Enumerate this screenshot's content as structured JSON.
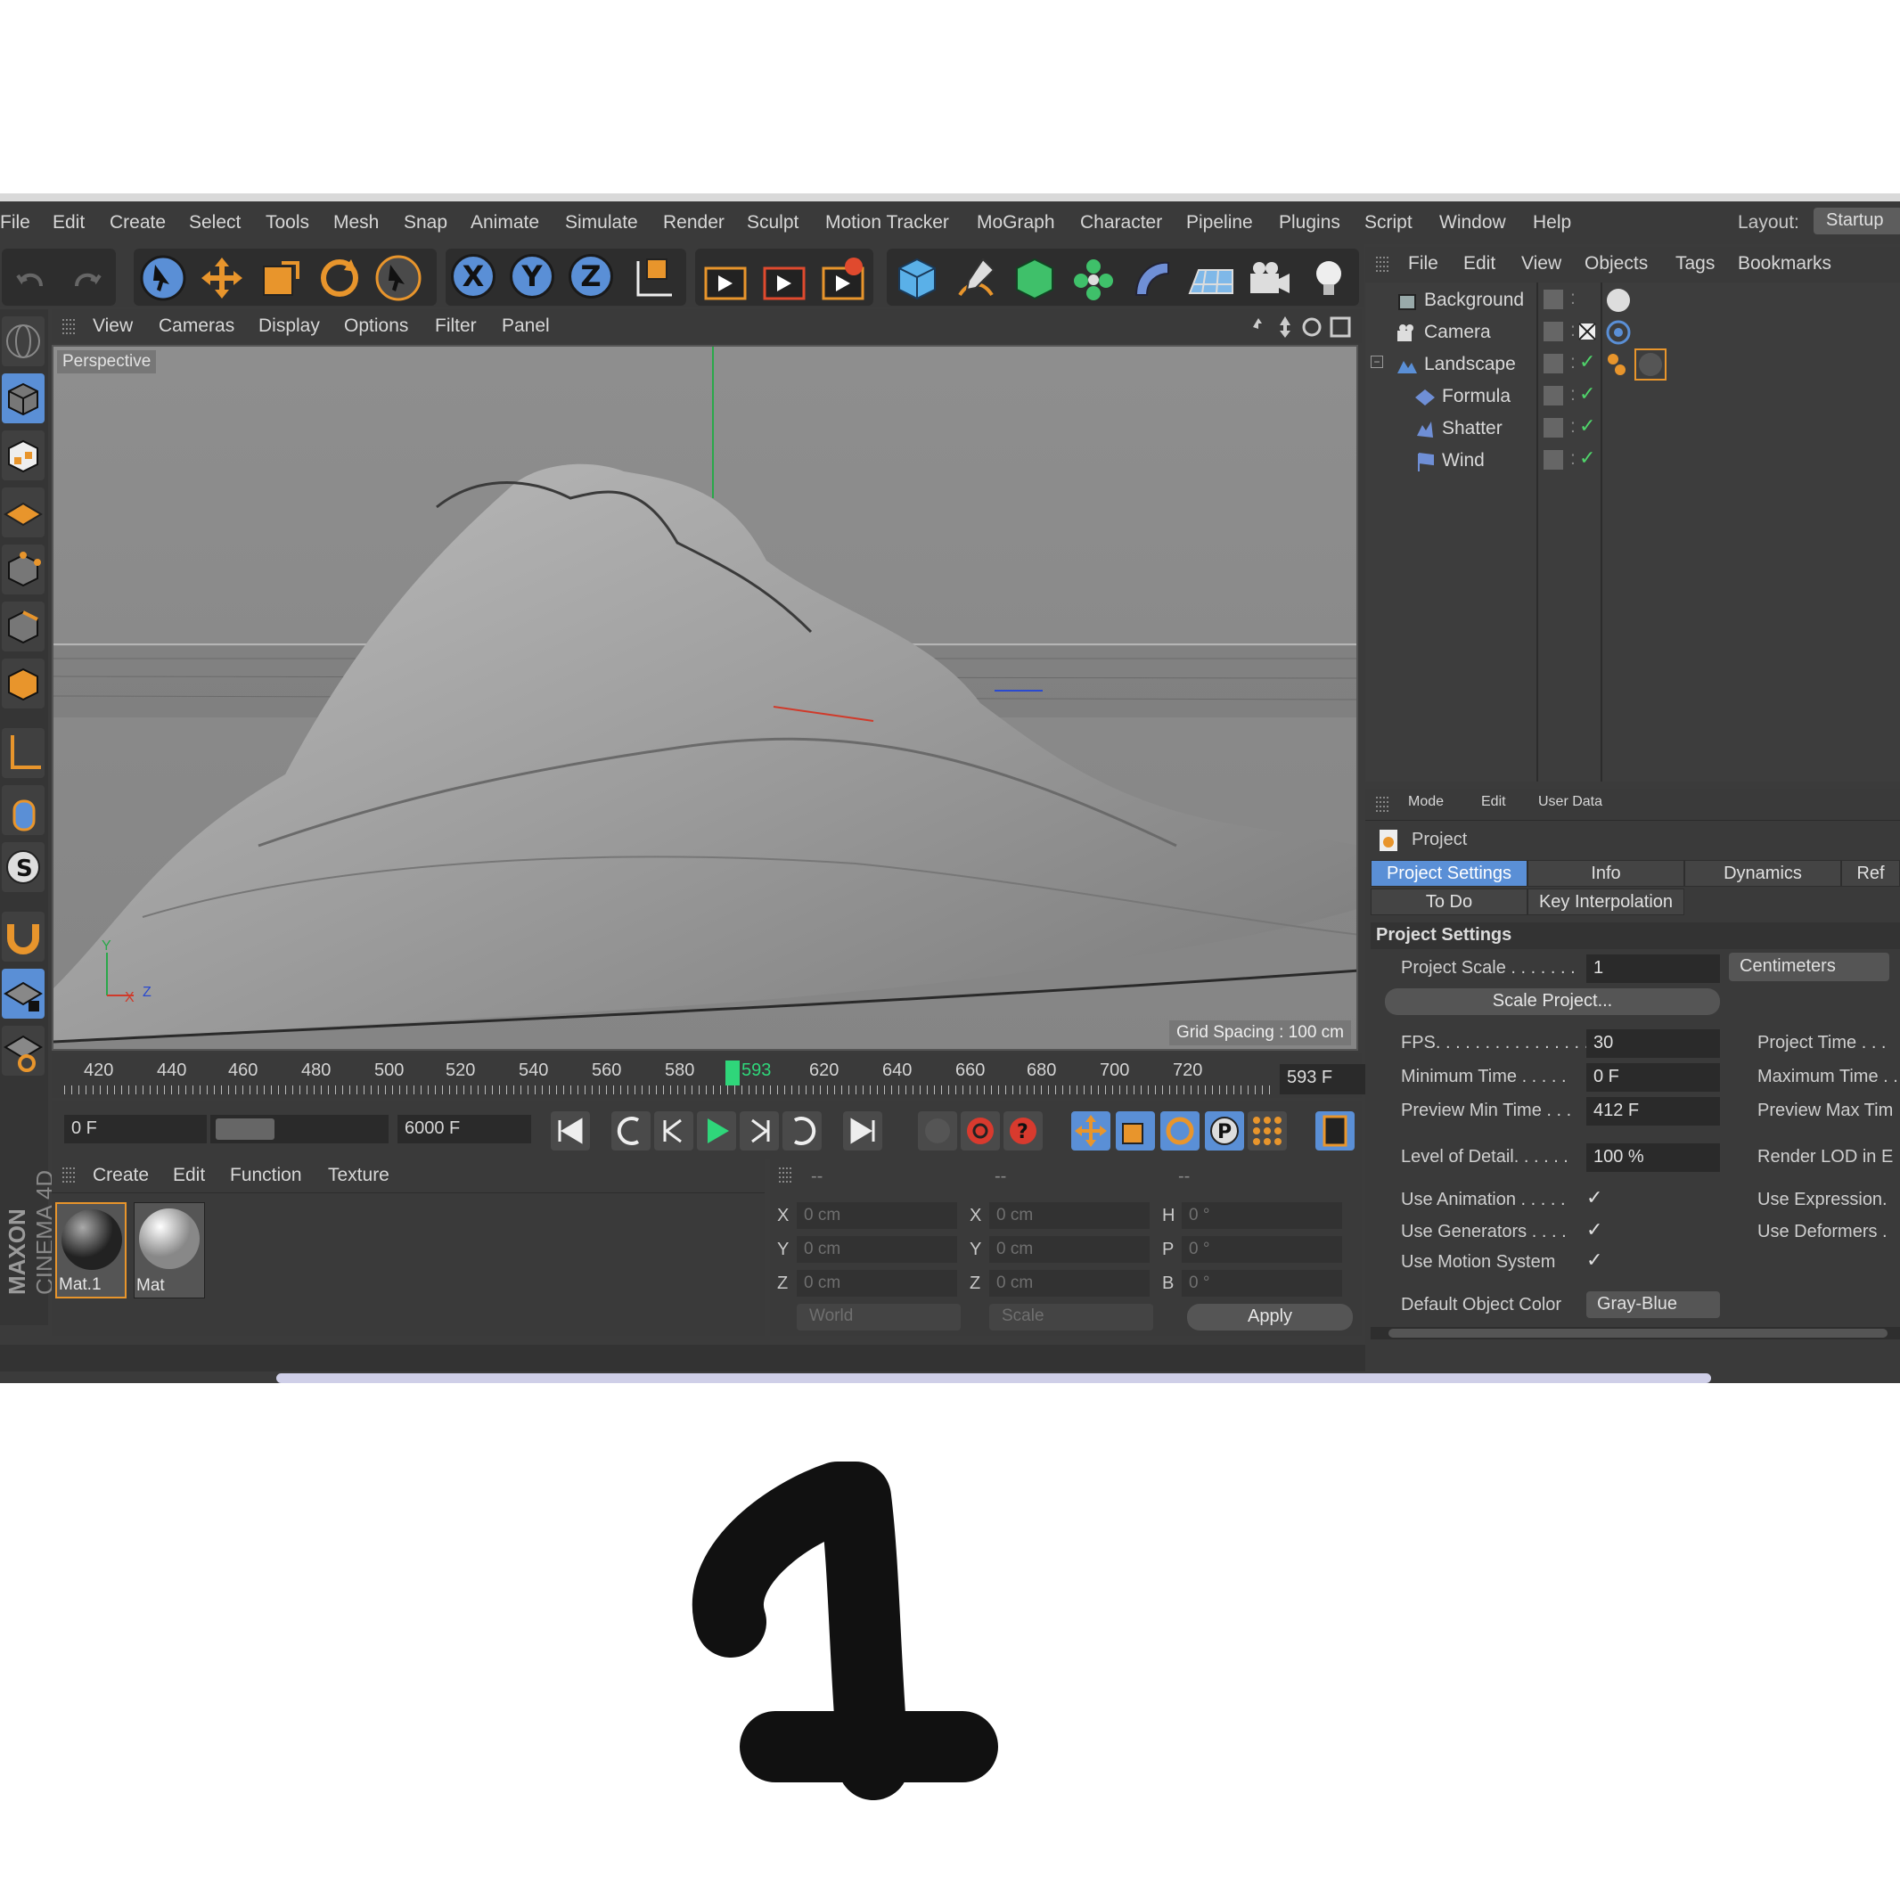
{
  "menubar": {
    "items": [
      "File",
      "Edit",
      "Create",
      "Select",
      "Tools",
      "Mesh",
      "Snap",
      "Animate",
      "Simulate",
      "Render",
      "Sculpt",
      "Motion Tracker",
      "MoGraph",
      "Character",
      "Pipeline",
      "Plugins",
      "Script",
      "Window",
      "Help"
    ],
    "layout_label": "Layout:",
    "layout_value": "Startup"
  },
  "main_toolbar": {
    "axis_buttons": [
      "X",
      "Y",
      "Z"
    ]
  },
  "viewport": {
    "menu": [
      "View",
      "Cameras",
      "Display",
      "Options",
      "Filter",
      "Panel"
    ],
    "label": "Perspective",
    "grid_spacing": "Grid Spacing : 100 cm",
    "axis_y": "Y",
    "axis_x": "X",
    "axis_z": "Z"
  },
  "timeline": {
    "ticks": [
      "420",
      "440",
      "460",
      "480",
      "500",
      "520",
      "540",
      "560",
      "580",
      "593",
      "620",
      "640",
      "660",
      "680",
      "700",
      "720"
    ],
    "current_frame": "593",
    "frame_counter": "593 F"
  },
  "playbar": {
    "start": "0 F",
    "end": "6000 F"
  },
  "materials": {
    "menu": [
      "Create",
      "Edit",
      "Function",
      "Texture"
    ],
    "items": [
      "Mat.1",
      "Mat"
    ],
    "brand_line1": "MAXON",
    "brand_line2": "CINEMA 4D"
  },
  "coords": {
    "header": [
      "--",
      "--",
      "--"
    ],
    "rows": [
      {
        "a": "X",
        "av": "0 cm",
        "b": "X",
        "bv": "0 cm",
        "c": "H",
        "cv": "0 °"
      },
      {
        "a": "Y",
        "av": "0 cm",
        "b": "Y",
        "bv": "0 cm",
        "c": "P",
        "cv": "0 °"
      },
      {
        "a": "Z",
        "av": "0 cm",
        "b": "Z",
        "bv": "0 cm",
        "c": "B",
        "cv": "0 °"
      }
    ],
    "mode": "World",
    "transform": "Scale",
    "apply": "Apply"
  },
  "objects": {
    "menu": [
      "File",
      "Edit",
      "View",
      "Objects",
      "Tags",
      "Bookmarks"
    ],
    "items": [
      {
        "name": "Background",
        "indent": 0
      },
      {
        "name": "Camera",
        "indent": 0
      },
      {
        "name": "Landscape",
        "indent": 0
      },
      {
        "name": "Formula",
        "indent": 1
      },
      {
        "name": "Shatter",
        "indent": 1
      },
      {
        "name": "Wind",
        "indent": 1
      }
    ]
  },
  "attributes": {
    "menu": [
      "Mode",
      "Edit",
      "User Data"
    ],
    "title": "Project",
    "tabs_row1": [
      "Project Settings",
      "Info",
      "Dynamics",
      "Ref"
    ],
    "tabs_row2": [
      "To Do",
      "Key Interpolation"
    ],
    "section": "Project Settings",
    "project_scale_label": "Project Scale . . . . . . .",
    "project_scale_value": "1",
    "project_scale_unit": "Centimeters",
    "scale_button": "Scale Project...",
    "fps_label": "FPS. . . . . . . . . . . . . . . .",
    "fps_value": "30",
    "project_time_label": "Project Time . . .",
    "min_time_label": "Minimum Time . . . . .",
    "min_time_value": "0 F",
    "max_time_label": "Maximum Time . .",
    "preview_min_label": "Preview Min Time . . .",
    "preview_min_value": "412 F",
    "preview_max_label": "Preview Max Tim",
    "lod_label": "Level of Detail. . . . . .",
    "lod_value": "100 %",
    "render_lod_label": "Render LOD in E",
    "use_animation": "Use Animation . . . . .",
    "use_expression": "Use Expression.",
    "use_generators": "Use Generators . . . .",
    "use_deformers": "Use Deformers .",
    "use_motion": "Use Motion System",
    "default_color_label": "Default Object Color",
    "default_color_value": "Gray-Blue"
  },
  "colors": {
    "accent_blue": "#5a8fd6",
    "orange": "#e8952c",
    "timeline_marker": "#2fd67a",
    "check_green": "#4fd46a"
  }
}
